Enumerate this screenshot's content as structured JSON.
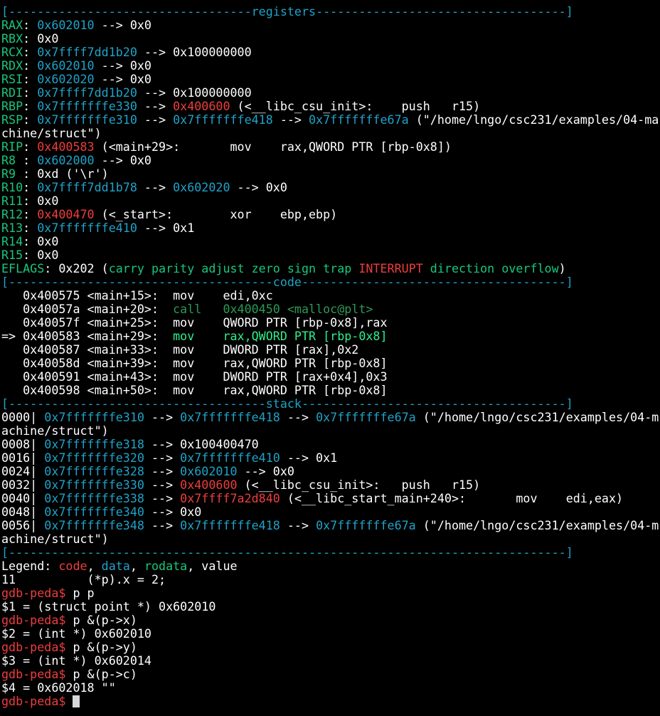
{
  "colors": {
    "background": "#000000",
    "default_text": "#ffffff",
    "register_and_separator": "#1fa3c8",
    "register_name_and_prompt_alt": "#19c77c",
    "code_address_and_prompt": "#ee3d3d",
    "current_instruction": "#2ef08a",
    "past_instruction_dim": "#7b7b7b"
  },
  "terminal": {
    "cursor": "block",
    "lines": [
      [
        [
          "[----------------------------------",
          "t-cyan"
        ],
        [
          "registers",
          "t-cyan"
        ],
        [
          "-----------------------------------]",
          "t-cyan"
        ]
      ],
      [
        [
          "RAX",
          "t-green"
        ],
        [
          ": ",
          "t-white"
        ],
        [
          "0x602010",
          "t-cyan"
        ],
        [
          " --> 0x0",
          "t-white"
        ]
      ],
      [
        [
          "RBX",
          "t-green"
        ],
        [
          ": 0x0",
          "t-white"
        ]
      ],
      [
        [
          "RCX",
          "t-green"
        ],
        [
          ": ",
          "t-white"
        ],
        [
          "0x7ffff7dd1b20",
          "t-cyan"
        ],
        [
          " --> 0x100000000",
          "t-white"
        ]
      ],
      [
        [
          "RDX",
          "t-green"
        ],
        [
          ": ",
          "t-white"
        ],
        [
          "0x602010",
          "t-cyan"
        ],
        [
          " --> 0x0",
          "t-white"
        ]
      ],
      [
        [
          "RSI",
          "t-green"
        ],
        [
          ": ",
          "t-white"
        ],
        [
          "0x602020",
          "t-cyan"
        ],
        [
          " --> 0x0",
          "t-white"
        ]
      ],
      [
        [
          "RDI",
          "t-green"
        ],
        [
          ": ",
          "t-white"
        ],
        [
          "0x7ffff7dd1b20",
          "t-cyan"
        ],
        [
          " --> 0x100000000",
          "t-white"
        ]
      ],
      [
        [
          "RBP",
          "t-green"
        ],
        [
          ": ",
          "t-white"
        ],
        [
          "0x7fffffffe330",
          "t-cyan"
        ],
        [
          " --> ",
          "t-white"
        ],
        [
          "0x400600",
          "t-red"
        ],
        [
          " (<__libc_csu_init>:    push   r15)",
          "t-white"
        ]
      ],
      [
        [
          "RSP",
          "t-green"
        ],
        [
          ": ",
          "t-white"
        ],
        [
          "0x7fffffffe310",
          "t-cyan"
        ],
        [
          " --> ",
          "t-white"
        ],
        [
          "0x7fffffffe418",
          "t-cyan"
        ],
        [
          " --> ",
          "t-white"
        ],
        [
          "0x7fffffffe67a",
          "t-cyan"
        ],
        [
          " (\"/home/lngo/csc231/examples/04-ma",
          "t-white"
        ]
      ],
      [
        [
          "chine/struct\")",
          "t-white"
        ]
      ],
      [
        [
          "RIP",
          "t-green"
        ],
        [
          ": ",
          "t-white"
        ],
        [
          "0x400583",
          "t-red"
        ],
        [
          " (<main+29>:       mov    rax,QWORD PTR [rbp-0x8])",
          "t-white"
        ]
      ],
      [
        [
          "R8 ",
          "t-green"
        ],
        [
          ": ",
          "t-white"
        ],
        [
          "0x602000",
          "t-cyan"
        ],
        [
          " --> 0x0",
          "t-white"
        ]
      ],
      [
        [
          "R9 ",
          "t-green"
        ],
        [
          ": 0xd ('\\r')",
          "t-white"
        ]
      ],
      [
        [
          "R10",
          "t-green"
        ],
        [
          ": ",
          "t-white"
        ],
        [
          "0x7ffff7dd1b78",
          "t-cyan"
        ],
        [
          " --> ",
          "t-white"
        ],
        [
          "0x602020",
          "t-cyan"
        ],
        [
          " --> 0x0",
          "t-white"
        ]
      ],
      [
        [
          "R11",
          "t-green"
        ],
        [
          ": 0x0",
          "t-white"
        ]
      ],
      [
        [
          "R12",
          "t-green"
        ],
        [
          ": ",
          "t-white"
        ],
        [
          "0x400470",
          "t-red"
        ],
        [
          " (<_start>:        xor    ebp,ebp)",
          "t-white"
        ]
      ],
      [
        [
          "R13",
          "t-green"
        ],
        [
          ": ",
          "t-white"
        ],
        [
          "0x7fffffffe410",
          "t-cyan"
        ],
        [
          " --> 0x1",
          "t-white"
        ]
      ],
      [
        [
          "R14",
          "t-green"
        ],
        [
          ": 0x0",
          "t-white"
        ]
      ],
      [
        [
          "R15",
          "t-green"
        ],
        [
          ": 0x0",
          "t-white"
        ]
      ],
      [
        [
          "EFLAGS",
          "t-green"
        ],
        [
          ": 0x202 (",
          "t-white"
        ],
        [
          "carry parity adjust zero sign trap ",
          "t-green"
        ],
        [
          "INTERRUPT",
          "t-red"
        ],
        [
          " direction overflow",
          "t-green"
        ],
        [
          ")",
          "t-white"
        ]
      ],
      [
        [
          "[-------------------------------------",
          "t-cyan"
        ],
        [
          "code",
          "t-cyan"
        ],
        [
          "-------------------------------------]",
          "t-cyan"
        ]
      ],
      [
        [
          "   0x400575 <main+15>:  mov    edi,0xc",
          "t-white"
        ]
      ],
      [
        [
          "   0x40057a <main+20>:  ",
          "t-white"
        ],
        [
          "call   0x400450 <malloc@plt>",
          "t-dimgreen"
        ]
      ],
      [
        [
          "   0x40057f <main+25>:  mov    QWORD PTR [rbp-0x8],rax",
          "t-white"
        ]
      ],
      [
        [
          "=> 0x400583 <main+29>:  ",
          "t-white"
        ],
        [
          "mov    rax,QWORD PTR [rbp-0x8]",
          "t-brightgreen"
        ]
      ],
      [
        [
          "   0x400587 <main+33>:  mov    DWORD PTR [rax],0x2",
          "t-white"
        ]
      ],
      [
        [
          "   0x40058d <main+39>:  mov    rax,QWORD PTR [rbp-0x8]",
          "t-white"
        ]
      ],
      [
        [
          "   0x400591 <main+43>:  mov    DWORD PTR [rax+0x4],0x3",
          "t-white"
        ]
      ],
      [
        [
          "   0x400598 <main+50>:  mov    rax,QWORD PTR [rbp-0x8]",
          "t-white"
        ]
      ],
      [
        [
          "[------------------------------------",
          "t-cyan"
        ],
        [
          "stack",
          "t-cyan"
        ],
        [
          "-------------------------------------]",
          "t-cyan"
        ]
      ],
      [
        [
          "0000| ",
          "t-white"
        ],
        [
          "0x7fffffffe310",
          "t-cyan"
        ],
        [
          " --> ",
          "t-white"
        ],
        [
          "0x7fffffffe418",
          "t-cyan"
        ],
        [
          " --> ",
          "t-white"
        ],
        [
          "0x7fffffffe67a",
          "t-cyan"
        ],
        [
          " (\"/home/lngo/csc231/examples/04-m",
          "t-white"
        ]
      ],
      [
        [
          "achine/struct\")",
          "t-white"
        ]
      ],
      [
        [
          "0008| ",
          "t-white"
        ],
        [
          "0x7fffffffe318",
          "t-cyan"
        ],
        [
          " --> 0x100400470",
          "t-white"
        ]
      ],
      [
        [
          "0016| ",
          "t-white"
        ],
        [
          "0x7fffffffe320",
          "t-cyan"
        ],
        [
          " --> ",
          "t-white"
        ],
        [
          "0x7fffffffe410",
          "t-cyan"
        ],
        [
          " --> 0x1",
          "t-white"
        ]
      ],
      [
        [
          "0024| ",
          "t-white"
        ],
        [
          "0x7fffffffe328",
          "t-cyan"
        ],
        [
          " --> ",
          "t-white"
        ],
        [
          "0x602010",
          "t-cyan"
        ],
        [
          " --> 0x0",
          "t-white"
        ]
      ],
      [
        [
          "0032| ",
          "t-white"
        ],
        [
          "0x7fffffffe330",
          "t-cyan"
        ],
        [
          " --> ",
          "t-white"
        ],
        [
          "0x400600",
          "t-red"
        ],
        [
          " (<__libc_csu_init>:   push   r15)",
          "t-white"
        ]
      ],
      [
        [
          "0040| ",
          "t-white"
        ],
        [
          "0x7fffffffe338",
          "t-cyan"
        ],
        [
          " --> ",
          "t-white"
        ],
        [
          "0x7ffff7a2d840",
          "t-red"
        ],
        [
          " (<__libc_start_main+240>:       mov    edi,eax)",
          "t-white"
        ]
      ],
      [
        [
          "0048| ",
          "t-white"
        ],
        [
          "0x7fffffffe340",
          "t-cyan"
        ],
        [
          " --> 0x0",
          "t-white"
        ]
      ],
      [
        [
          "0056| ",
          "t-white"
        ],
        [
          "0x7fffffffe348",
          "t-cyan"
        ],
        [
          " --> ",
          "t-white"
        ],
        [
          "0x7fffffffe418",
          "t-cyan"
        ],
        [
          " --> ",
          "t-white"
        ],
        [
          "0x7fffffffe67a",
          "t-cyan"
        ],
        [
          " (\"/home/lngo/csc231/examples/04-m",
          "t-white"
        ]
      ],
      [
        [
          "achine/struct\")",
          "t-white"
        ]
      ],
      [
        [
          "[------------------------------------------------------------------------------]",
          "t-cyan"
        ]
      ],
      [
        [
          "Legend: ",
          "t-white"
        ],
        [
          "code",
          "t-red"
        ],
        [
          ", ",
          "t-white"
        ],
        [
          "data",
          "t-cyan"
        ],
        [
          ", ",
          "t-white"
        ],
        [
          "rodata",
          "t-green"
        ],
        [
          ", value",
          "t-white"
        ]
      ],
      [
        [
          "11          (*p).x = 2;",
          "t-white"
        ]
      ],
      [
        [
          "gdb-peda$ ",
          "t-red"
        ],
        [
          "p p",
          "t-white"
        ]
      ],
      [
        [
          "$1 = (struct point *) 0x602010",
          "t-white"
        ]
      ],
      [
        [
          "gdb-peda$ ",
          "t-red"
        ],
        [
          "p &(p->x)",
          "t-white"
        ]
      ],
      [
        [
          "$2 = (int *) 0x602010",
          "t-white"
        ]
      ],
      [
        [
          "gdb-peda$ ",
          "t-red"
        ],
        [
          "p &(p->y)",
          "t-white"
        ]
      ],
      [
        [
          "$3 = (int *) 0x602014",
          "t-white"
        ]
      ],
      [
        [
          "gdb-peda$ ",
          "t-red"
        ],
        [
          "p &(p->c)",
          "t-white"
        ]
      ],
      [
        [
          "$4 = 0x602018 \"\"",
          "t-white"
        ]
      ],
      [
        [
          "gdb-peda$ ",
          "t-red"
        ]
      ]
    ]
  }
}
